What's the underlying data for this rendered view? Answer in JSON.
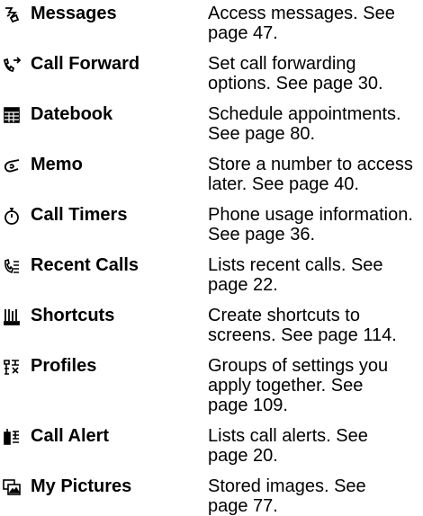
{
  "menu": {
    "items": [
      {
        "icon": "messages-icon",
        "name": "Messages",
        "desc_lines": [
          "Access messages. See",
          "page 47."
        ]
      },
      {
        "icon": "call-forward-icon",
        "name": "Call Forward",
        "desc_lines": [
          "Set call forwarding",
          "options. See page 30."
        ]
      },
      {
        "icon": "datebook-icon",
        "name": "Datebook",
        "desc_lines": [
          "Schedule appointments.",
          "See page 80."
        ]
      },
      {
        "icon": "memo-icon",
        "name": "Memo",
        "desc_lines": [
          "Store a number to access",
          "later. See page 40."
        ]
      },
      {
        "icon": "call-timers-icon",
        "name": "Call Timers",
        "desc_lines": [
          "Phone usage information.",
          "See page 36."
        ]
      },
      {
        "icon": "recent-calls-icon",
        "name": "Recent Calls",
        "desc_lines": [
          "Lists recent calls. See",
          "page 22."
        ]
      },
      {
        "icon": "shortcuts-icon",
        "name": "Shortcuts",
        "desc_lines": [
          "Create shortcuts to",
          "screens. See page 114."
        ]
      },
      {
        "icon": "profiles-icon",
        "name": "Profiles",
        "desc_lines": [
          "Groups of settings you",
          "apply together. See",
          "page 109."
        ]
      },
      {
        "icon": "call-alert-icon",
        "name": "Call Alert",
        "desc_lines": [
          "Lists call alerts. See",
          "page 20."
        ]
      },
      {
        "icon": "my-pictures-icon",
        "name": "My Pictures",
        "desc_lines": [
          "Stored images. See",
          "page 77."
        ]
      }
    ]
  }
}
